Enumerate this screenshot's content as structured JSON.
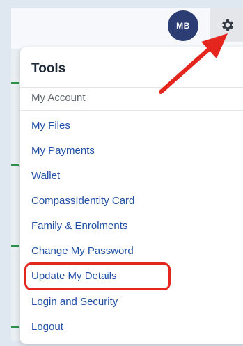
{
  "header": {
    "avatar_initials": "MB",
    "avatar_color": "#2c3d73",
    "settings_icon": "gear-icon"
  },
  "menu": {
    "title": "Tools",
    "section_label": "My Account",
    "items": [
      {
        "label": "My Files"
      },
      {
        "label": "My Payments"
      },
      {
        "label": "Wallet"
      },
      {
        "label": "CompassIdentity Card"
      },
      {
        "label": "Family & Enrolments"
      },
      {
        "label": "Change My Password"
      },
      {
        "label": "Update My Details",
        "highlighted": true
      },
      {
        "label": "Login and Security"
      },
      {
        "label": "Logout"
      }
    ]
  },
  "annotation": {
    "arrow_color": "#e5261f",
    "highlight_color": "#e5261f"
  }
}
